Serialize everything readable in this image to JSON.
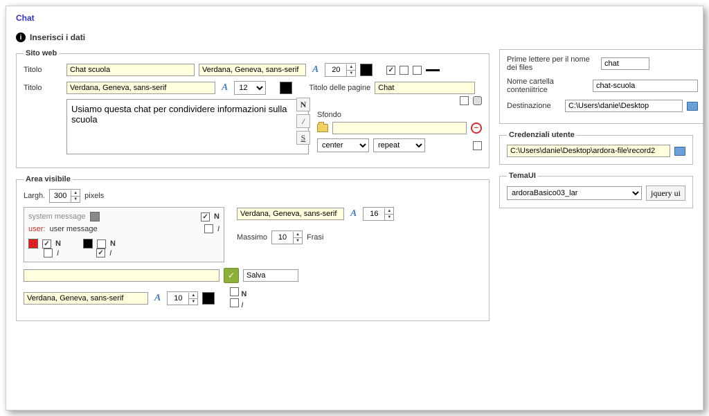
{
  "app": {
    "title": "Chat"
  },
  "header": {
    "info_label": "i",
    "insert_data": "Inserisci i dati"
  },
  "sitoweb": {
    "legend": "Sito web",
    "titolo_label": "Titolo",
    "titolo1_value": "Chat scuola",
    "font1_value": "Verdana, Geneva, sans-serif",
    "size1": "20",
    "titolo2_label": "Titolo",
    "font2_value": "Verdana, Geneva, sans-serif",
    "size2": "12",
    "pages_title_label": "Titolo delle pagine",
    "pages_title_value": "Chat",
    "desc_value": "Usiamo questa chat per condividere informazioni sulla scuola",
    "sfondo_label": "Sfondo",
    "sfondo_path": "",
    "pos_value": "center",
    "repeat_value": "repeat",
    "bold_btn": "N",
    "italic_btn": "/",
    "underline_btn": "S"
  },
  "right": {
    "prime_lettere_label": "Prime lettere per il nome dei files",
    "prime_lettere_value": "chat",
    "cartella_label": "Nome cartella conteniitrice",
    "cartella_value": "chat-scuola",
    "dest_label": "Destinazione",
    "dest_value": "C:\\Users\\danie\\Desktop",
    "cred_legend": "Credenziali utente",
    "cred_value": "C:\\Users\\danie\\Desktop\\ardora-file\\record2",
    "tema_legend": "TemaUI",
    "tema_value": "ardoraBasico03_lar",
    "jquery_btn": "jquery ui"
  },
  "area": {
    "legend": "Area visibile",
    "largh_label": "Largh.",
    "largh_value": "300",
    "pixels_label": "pixels",
    "sys_text": "system message",
    "user_prefix": "user:",
    "user_text": "user message",
    "bold_N": "N",
    "ital_I": "I",
    "font_value": "Verdana, Geneva, sans-serif",
    "font_size": "16",
    "max_label": "Massimo",
    "max_value": "10",
    "frasi_label": "Frasi",
    "input_value": "",
    "salva_label": "Salva",
    "font2_value": "Verdana, Geneva, sans-serif",
    "font2_size": "10"
  }
}
